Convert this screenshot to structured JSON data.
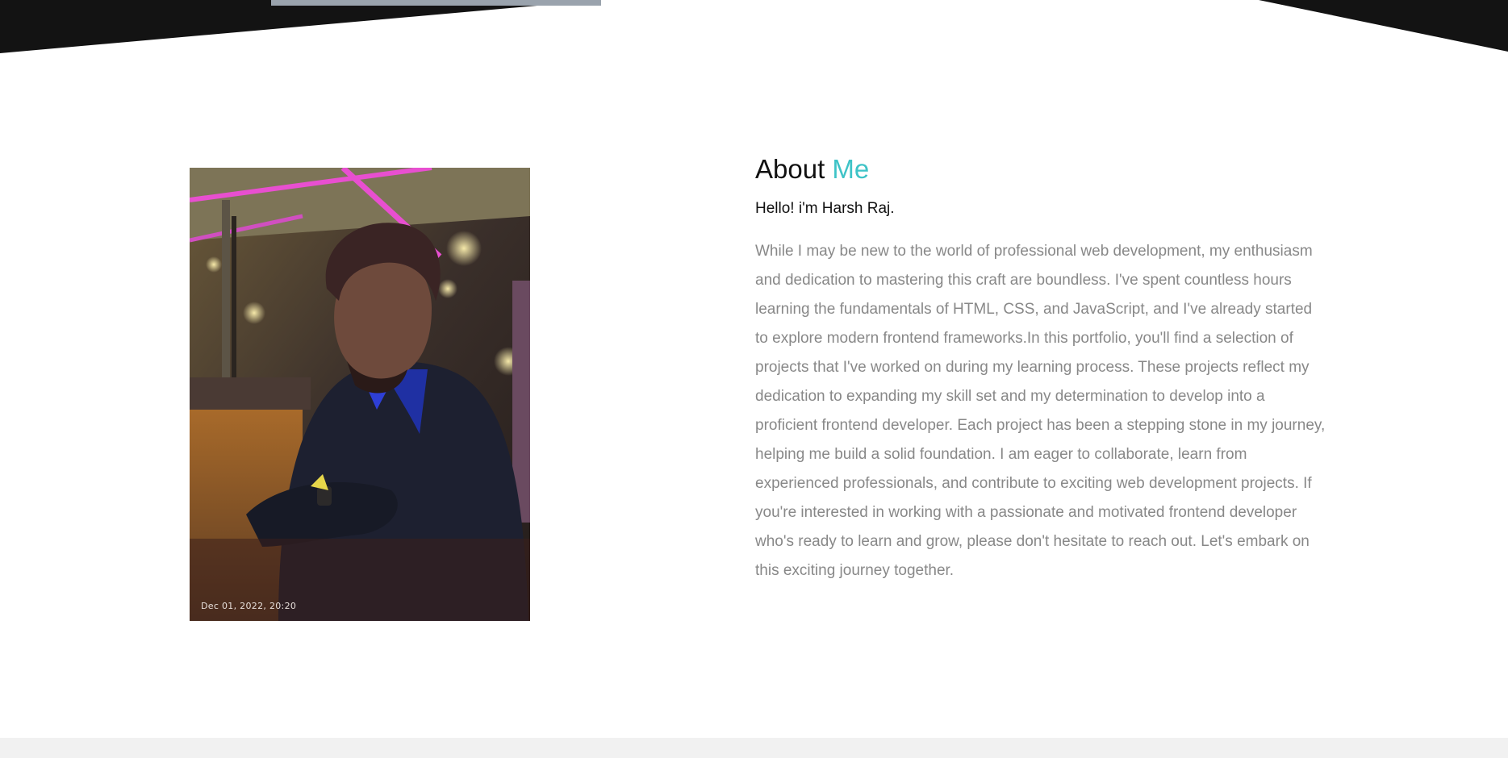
{
  "colors": {
    "accent": "#3ec3c7",
    "heading": "#111111",
    "body_text": "#888888",
    "hero_band": "#131313",
    "footer": "#f1f1f1"
  },
  "about": {
    "title_main": "About",
    "title_accent": "Me",
    "greeting": "Hello! i'm Harsh Raj.",
    "bio": "While I may be new to the world of professional web development, my enthusiasm and dedication to mastering this craft are boundless. I've spent countless hours learning the fundamentals of HTML, CSS, and JavaScript, and I've already started to explore modern frontend frameworks.In this portfolio, you'll find a selection of projects that I've worked on during my learning process. These projects reflect my dedication to expanding my skill set and my determination to develop into a proficient frontend developer. Each project has been a stepping stone in my journey, helping me build a solid foundation. I am eager to collaborate, learn from experienced professionals, and contribute to exciting web development projects. If you're interested in working with a passionate and motivated frontend developer who's ready to learn and grow, please don't hesitate to reach out. Let's embark on this exciting journey together.",
    "photo_stamp": "Dec 01, 2022, 20:20"
  }
}
